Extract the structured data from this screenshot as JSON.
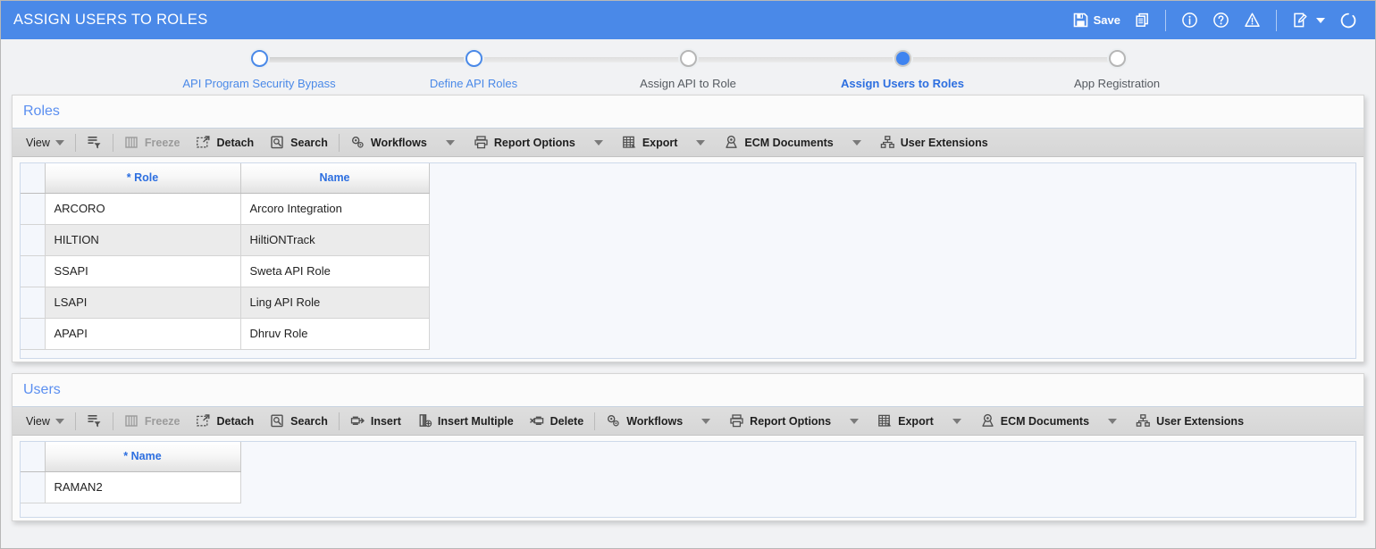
{
  "header": {
    "title": "ASSIGN USERS TO ROLES",
    "save_label": "Save",
    "icons": {
      "save": "floppy-disk-icon",
      "duplicate": "duplicate-pages-icon",
      "info": "info-circle-icon",
      "help": "help-circle-icon",
      "warning": "warning-triangle-icon",
      "notes": "edit-note-icon",
      "notes_caret": "chevron-down-icon",
      "refresh": "refresh-icon"
    }
  },
  "train": {
    "stops": [
      {
        "label": "API Program Security Bypass",
        "state": "visited"
      },
      {
        "label": "Define API Roles",
        "state": "visited"
      },
      {
        "label": "Assign API to Role",
        "state": "pending"
      },
      {
        "label": "Assign Users to Roles",
        "state": "current"
      },
      {
        "label": "App Registration",
        "state": "pending"
      }
    ]
  },
  "roles_panel": {
    "title": "Roles",
    "toolbar": [
      {
        "label": "View",
        "icon": "none",
        "caret": true,
        "bold": false,
        "disabled": false
      },
      {
        "label": "",
        "icon": "detach-query-icon",
        "caret": false,
        "bold": false,
        "disabled": false
      },
      {
        "label": "Freeze",
        "icon": "freeze-columns-icon",
        "caret": false,
        "bold": true,
        "disabled": true
      },
      {
        "label": "Detach",
        "icon": "detach-icon",
        "caret": false,
        "bold": true,
        "disabled": false
      },
      {
        "label": "Search",
        "icon": "search-icon",
        "caret": false,
        "bold": true,
        "disabled": false
      },
      {
        "label": "Workflows",
        "icon": "workflows-gears-icon",
        "caret": true,
        "bold": true,
        "disabled": false
      },
      {
        "label": "Report Options",
        "icon": "printer-icon",
        "caret": true,
        "bold": true,
        "disabled": false
      },
      {
        "label": "Export",
        "icon": "export-spreadsheet-icon",
        "caret": true,
        "bold": true,
        "disabled": false
      },
      {
        "label": "ECM Documents",
        "icon": "ecm-documents-icon",
        "caret": true,
        "bold": true,
        "disabled": false
      },
      {
        "label": "User Extensions",
        "icon": "user-extensions-icon",
        "caret": false,
        "bold": true,
        "disabled": false
      }
    ],
    "columns": [
      "* Role",
      "Name"
    ],
    "rows": [
      {
        "role": "ARCORO",
        "name": "Arcoro Integration"
      },
      {
        "role": "HILTION",
        "name": "HiltiONTrack"
      },
      {
        "role": "SSAPI",
        "name": "Sweta API Role"
      },
      {
        "role": "LSAPI",
        "name": "Ling API Role"
      },
      {
        "role": "APAPI",
        "name": "Dhruv Role"
      }
    ]
  },
  "users_panel": {
    "title": "Users",
    "toolbar": [
      {
        "label": "View",
        "icon": "none",
        "caret": true,
        "bold": false,
        "disabled": false
      },
      {
        "label": "",
        "icon": "detach-query-icon",
        "caret": false,
        "bold": false,
        "disabled": false
      },
      {
        "label": "Freeze",
        "icon": "freeze-columns-icon",
        "caret": false,
        "bold": true,
        "disabled": true
      },
      {
        "label": "Detach",
        "icon": "detach-icon",
        "caret": false,
        "bold": true,
        "disabled": false
      },
      {
        "label": "Search",
        "icon": "search-icon",
        "caret": false,
        "bold": true,
        "disabled": false
      },
      {
        "label": "Insert",
        "icon": "insert-row-icon",
        "caret": false,
        "bold": true,
        "disabled": false
      },
      {
        "label": "Insert Multiple",
        "icon": "insert-multiple-icon",
        "caret": false,
        "bold": true,
        "disabled": false
      },
      {
        "label": "Delete",
        "icon": "delete-row-icon",
        "caret": false,
        "bold": true,
        "disabled": false
      },
      {
        "label": "Workflows",
        "icon": "workflows-gears-icon",
        "caret": true,
        "bold": true,
        "disabled": false
      },
      {
        "label": "Report Options",
        "icon": "printer-icon",
        "caret": true,
        "bold": true,
        "disabled": false
      },
      {
        "label": "Export",
        "icon": "export-spreadsheet-icon",
        "caret": true,
        "bold": true,
        "disabled": false
      },
      {
        "label": "ECM Documents",
        "icon": "ecm-documents-icon",
        "caret": true,
        "bold": true,
        "disabled": false
      },
      {
        "label": "User Extensions",
        "icon": "user-extensions-icon",
        "caret": false,
        "bold": true,
        "disabled": false
      }
    ],
    "columns": [
      "* Name"
    ],
    "rows": [
      {
        "name": "RAMAN2"
      }
    ]
  },
  "colors": {
    "appbar": "#4a89e8",
    "accent_link": "#2d6fe0",
    "panel_title": "#5b8ff0",
    "page_bg": "#f1f2f4",
    "toolbar_bg": "#dedede",
    "grid_bg": "#f6f8fc",
    "row_alt": "#ebebeb"
  }
}
